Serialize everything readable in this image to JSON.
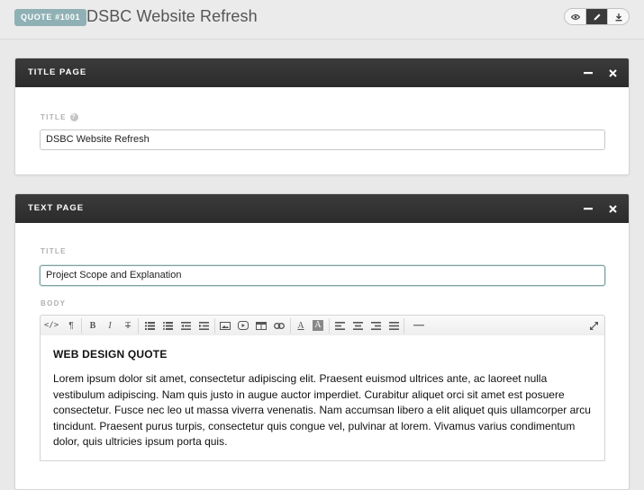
{
  "header": {
    "badge": "QUOTE #1001",
    "title": "DSBC Website Refresh",
    "view_modes": [
      {
        "icon": "eye-icon",
        "active": false
      },
      {
        "icon": "pencil-icon",
        "active": true
      },
      {
        "icon": "download-icon",
        "active": false
      }
    ]
  },
  "title_page": {
    "header": "TITLE PAGE",
    "field_label": "TITLE",
    "field_value": "DSBC Website Refresh"
  },
  "text_page": {
    "header": "TEXT PAGE",
    "title_label": "TITLE",
    "title_value": "Project Scope and Explanation",
    "body_label": "BODY",
    "toolbar": [
      "html-source-icon",
      "paragraph-icon",
      "bold-icon",
      "italic-icon",
      "strikethrough-icon",
      "unordered-list-icon",
      "ordered-list-icon",
      "outdent-icon",
      "indent-icon",
      "image-icon",
      "video-icon",
      "table-icon",
      "link-icon",
      "font-color-icon",
      "highlight-icon",
      "align-left-icon",
      "align-center-icon",
      "align-right-icon",
      "align-justify-icon",
      "horizontal-rule-icon",
      "fullscreen-icon"
    ],
    "body_heading": "WEB DESIGN QUOTE",
    "body_text": "Lorem ipsum dolor sit amet, consectetur adipiscing elit. Praesent euismod ultrices ante, ac laoreet nulla vestibulum adipiscing. Nam quis justo in augue auctor imperdiet. Curabitur aliquet orci sit amet est posuere consectetur. Fusce nec leo ut massa viverra venenatis. Nam accumsan libero a elit aliquet quis ullamcorper arcu tincidunt. Praesent purus turpis, consectetur quis congue vel, pulvinar at lorem. Vivamus varius condimentum dolor, quis ultricies ipsum porta quis."
  },
  "colors": {
    "badge_bg": "#8fb1b5",
    "panel_header_bg": "#333333",
    "focus_border": "#7ea2a2"
  }
}
